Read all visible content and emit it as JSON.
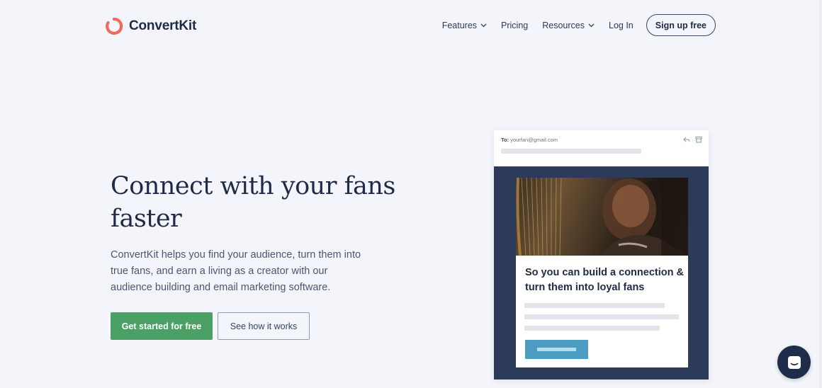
{
  "brand": {
    "name": "ConvertKit",
    "color": "#ef6b5b"
  },
  "nav": {
    "items": [
      {
        "label": "Features",
        "has_dropdown": true
      },
      {
        "label": "Pricing",
        "has_dropdown": false
      },
      {
        "label": "Resources",
        "has_dropdown": true
      },
      {
        "label": "Log In",
        "has_dropdown": false
      }
    ],
    "signup_label": "Sign up free"
  },
  "hero": {
    "title": "Connect with your fans faster",
    "subtitle": "ConvertKit helps you find your audience, turn them into true fans, and earn a living as a creator with our audience building and email marketing software.",
    "primary_cta": "Get started for free",
    "secondary_cta": "See how it works",
    "primary_color": "#4ba066"
  },
  "email_preview": {
    "to_label": "To:",
    "to_address": "yourfan@gmail.com",
    "headline": "So you can build a connection & turn them into loyal fans",
    "icons": [
      "reply-icon",
      "archive-icon"
    ]
  },
  "chat": {
    "icon": "chat-icon"
  }
}
